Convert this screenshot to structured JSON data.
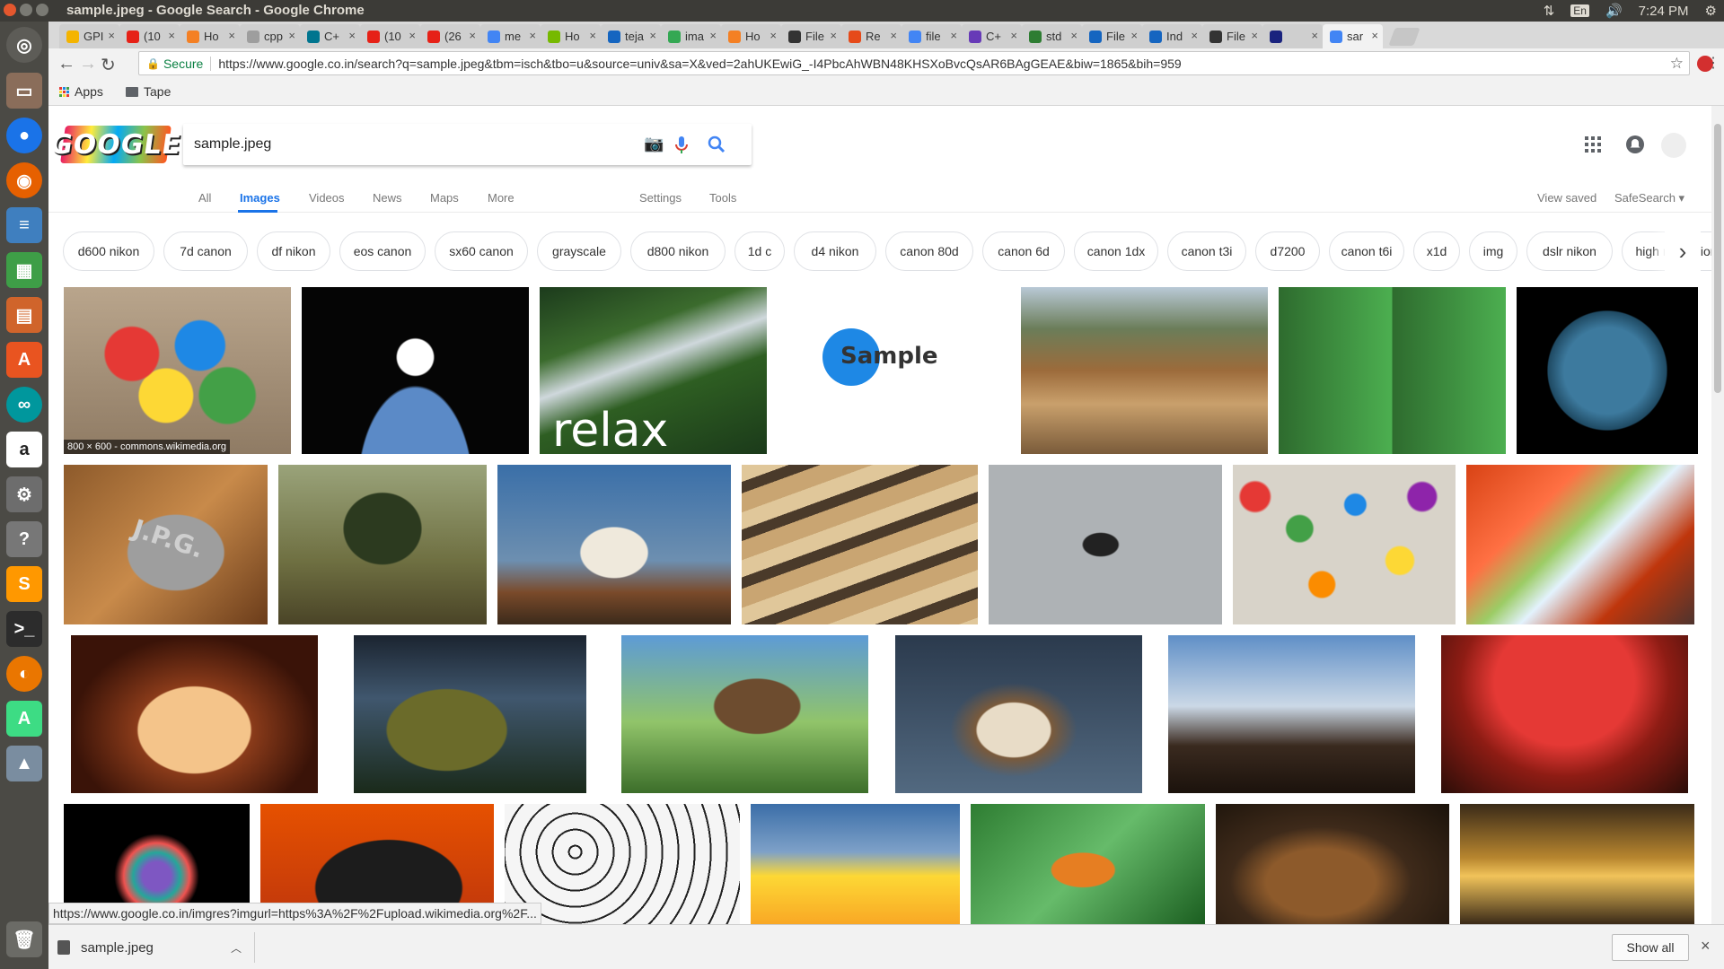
{
  "os": {
    "window_title": "sample.jpeg - Google Search - Google Chrome",
    "keyboard_layout": "En",
    "time": "7:24 PM"
  },
  "tabs": [
    {
      "label": "GPI",
      "color": "#f4b400"
    },
    {
      "label": "(10",
      "color": "#e62117"
    },
    {
      "label": "Ho",
      "color": "#f48024"
    },
    {
      "label": "cpp",
      "color": "#9e9e9e"
    },
    {
      "label": "C+",
      "color": "#00758f"
    },
    {
      "label": "(10",
      "color": "#e62117"
    },
    {
      "label": "(26",
      "color": "#e62117"
    },
    {
      "label": "me",
      "color": "#4285f4"
    },
    {
      "label": "Ho",
      "color": "#76b900"
    },
    {
      "label": "teja",
      "color": "#1565c0"
    },
    {
      "label": "ima",
      "color": "#34a853"
    },
    {
      "label": "Ho",
      "color": "#f48024"
    },
    {
      "label": "File",
      "color": "#333333"
    },
    {
      "label": "Re",
      "color": "#e64a19"
    },
    {
      "label": "file",
      "color": "#4285f4"
    },
    {
      "label": "C+",
      "color": "#673ab7"
    },
    {
      "label": "std",
      "color": "#2e7d32"
    },
    {
      "label": "File",
      "color": "#1565c0"
    },
    {
      "label": "Ind",
      "color": "#1565c0"
    },
    {
      "label": "File",
      "color": "#333333"
    },
    {
      "label": "",
      "color": "#1a237e"
    },
    {
      "label": "sar",
      "color": "#4285f4"
    }
  ],
  "toolbar": {
    "secure_label": "Secure",
    "url": "https://www.google.co.in/search?q=sample.jpeg&tbm=isch&tbo=u&source=univ&sa=X&ved=2ahUKEwiG_-I4PbcAhWBN48KHSXoBvcQsAR6BAgGEAE&biw=1865&bih=959"
  },
  "bookmarks": {
    "apps_label": "Apps",
    "folder_label": "Tape"
  },
  "search": {
    "logo_text": "GOOGLE",
    "query": "sample.jpeg"
  },
  "nav": {
    "all": "All",
    "images": "Images",
    "videos": "Videos",
    "news": "News",
    "maps": "Maps",
    "more": "More",
    "settings": "Settings",
    "tools": "Tools",
    "view_saved": "View saved",
    "safesearch": "SafeSearch ▾"
  },
  "chips": [
    "d600 nikon",
    "7d canon",
    "df nikon",
    "eos canon",
    "sx60 canon",
    "grayscale",
    "d800 nikon",
    "1d c",
    "d4 nikon",
    "canon 80d",
    "canon 6d",
    "canon 1dx",
    "canon t3i",
    "d7200",
    "canon t6i",
    "x1d",
    "img",
    "dslr nikon",
    "high resolution"
  ],
  "images": {
    "first_caption": "800 × 600 - commons.wikimedia.org",
    "relax_text": "relax",
    "sample_text": "Sample",
    "jpg_text": "J.P.G."
  },
  "status_url": "https://www.google.co.in/imgres?imgurl=https%3A%2F%2Fupload.wikimedia.org%2F...",
  "download": {
    "filename": "sample.jpeg",
    "show_all": "Show all"
  }
}
